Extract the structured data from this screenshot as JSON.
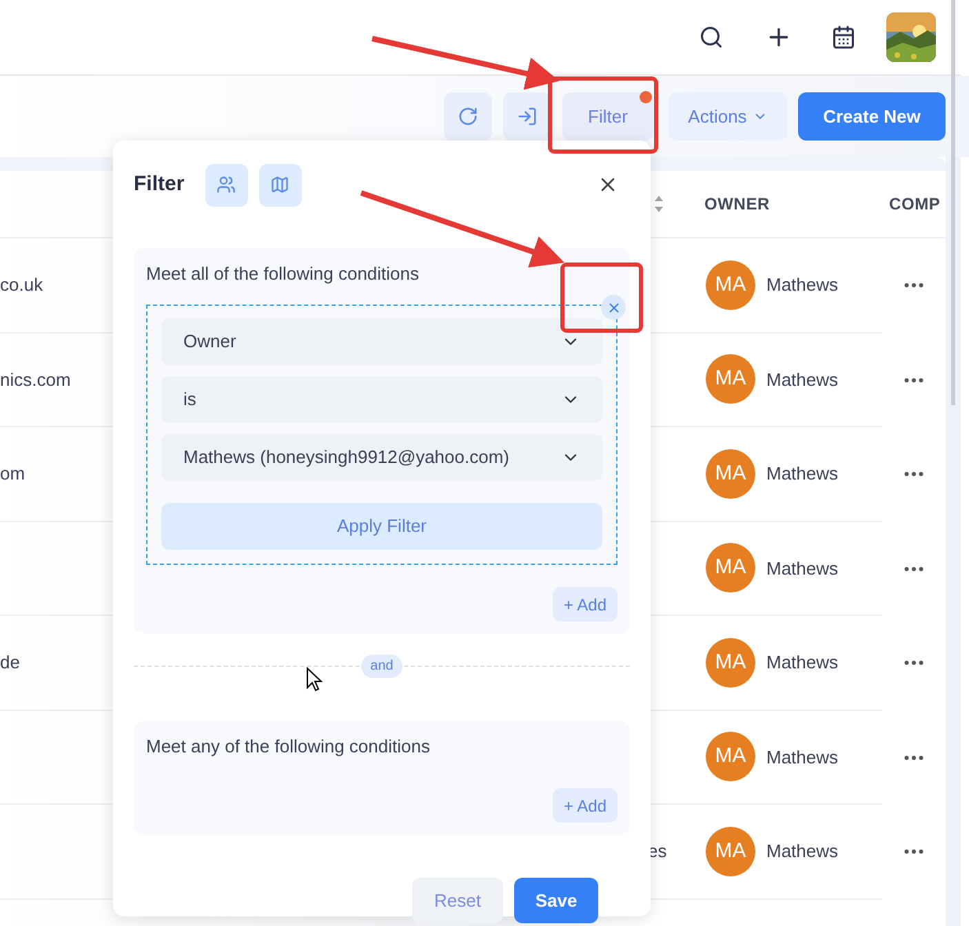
{
  "toolbar": {
    "filter_label": "Filter",
    "filter_active": true,
    "actions_label": "Actions",
    "create_label": "Create New"
  },
  "table": {
    "columns": [
      {
        "label": "OWNER"
      },
      {
        "label": "COMP"
      }
    ],
    "rows": [
      {
        "column_1": "co.uk",
        "owner_initials": "MA",
        "owner": "Mathews"
      },
      {
        "column_1": "nics.com",
        "owner_initials": "MA",
        "owner": "Mathews"
      },
      {
        "column_1": "om",
        "owner_initials": "MA",
        "owner": "Mathews"
      },
      {
        "owner_initials": "MA",
        "owner": "Mathews"
      },
      {
        "column_1": "de",
        "owner_initials": "MA",
        "owner": "Mathews"
      },
      {
        "owner_initials": "MA",
        "owner": "Mathews"
      },
      {
        "column_2": "es",
        "owner_initials": "MA",
        "owner": "Mathews"
      }
    ]
  },
  "filter_panel": {
    "title": "Filter",
    "groups": [
      {
        "heading": "Meet all of the following conditions",
        "add_label": "+ Add",
        "conditions": [
          {
            "selects": [
              "Owner",
              "is",
              "Mathews (honeysingh9912@yahoo.com)"
            ],
            "apply_label": "Apply Filter"
          }
        ]
      },
      {
        "heading": "Meet any of the following conditions",
        "add_label": "+ Add"
      }
    ],
    "joiner": "and",
    "reset_label": "Reset",
    "save_label": "Save"
  }
}
